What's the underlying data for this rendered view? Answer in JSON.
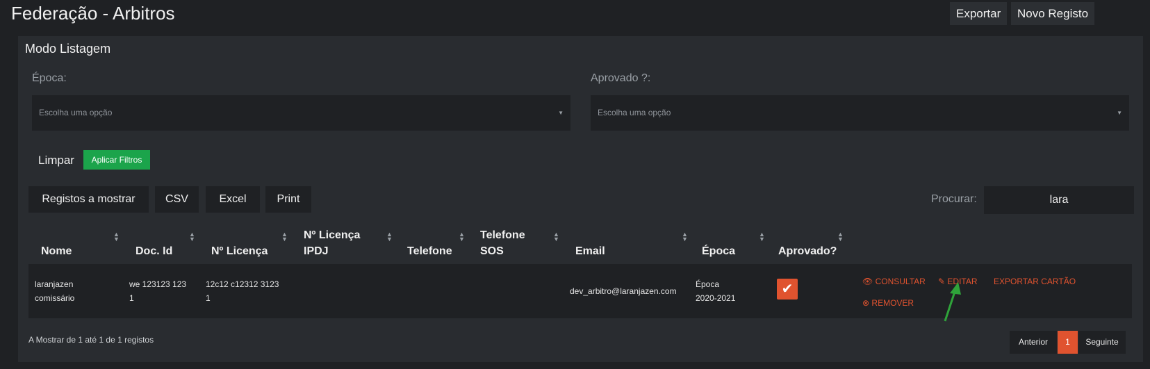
{
  "header": {
    "title": "Federação - Arbitros",
    "export_label": "Exportar",
    "new_label": "Novo Registo"
  },
  "panel": {
    "title": "Modo Listagem"
  },
  "filters": {
    "epoca_label": "Época:",
    "aprovado_label": "Aprovado ?:",
    "epoca_placeholder": "Escolha uma opção",
    "aprovado_placeholder": "Escolha uma opção",
    "clear_label": "Limpar",
    "apply_label": "Aplicar Filtros"
  },
  "toolbar": {
    "show_label": "Registos a mostrar",
    "csv_label": "CSV",
    "excel_label": "Excel",
    "print_label": "Print",
    "search_label": "Procurar:",
    "search_value": "lara"
  },
  "table": {
    "columns": {
      "nome": "Nome",
      "doc_id": "Doc. Id",
      "licenca": "Nº Licença",
      "licenca_ipdj_1": "Nº Licença",
      "licenca_ipdj_2": "IPDJ",
      "telefone": "Telefone",
      "telefone_sos_1": "Telefone",
      "telefone_sos_2": "SOS",
      "email": "Email",
      "epoca": "Época",
      "aprovado": "Aprovado?"
    },
    "rows": [
      {
        "nome_1": "laranjazen",
        "nome_2": "comissário",
        "doc_1": "we 123123 123",
        "doc_2": "1",
        "lic_1": "12c12 c12312 3123",
        "lic_2": "1",
        "email": "dev_arbitro@laranjazen.com",
        "epoca_1": "Época",
        "epoca_2": "2020-2021",
        "aprovado": true
      }
    ],
    "actions": {
      "consultar": "CONSULTAR",
      "editar": "EDITAR",
      "exportar": "EXPORTAR CARTÃO",
      "remover": "REMOVER"
    }
  },
  "footer": {
    "info": "A Mostrar de 1 até 1 de 1 registos",
    "prev": "Anterior",
    "page": "1",
    "next": "Seguinte"
  },
  "colors": {
    "accent": "#e0532f",
    "success": "#1ba44b",
    "arrow": "#2fa33a"
  },
  "icons": {
    "check": "check-icon",
    "eye": "eye-icon",
    "edit": "edit-icon",
    "remove": "x-circle-icon",
    "sort": "sort-icon",
    "caret": "caret-down-icon"
  }
}
